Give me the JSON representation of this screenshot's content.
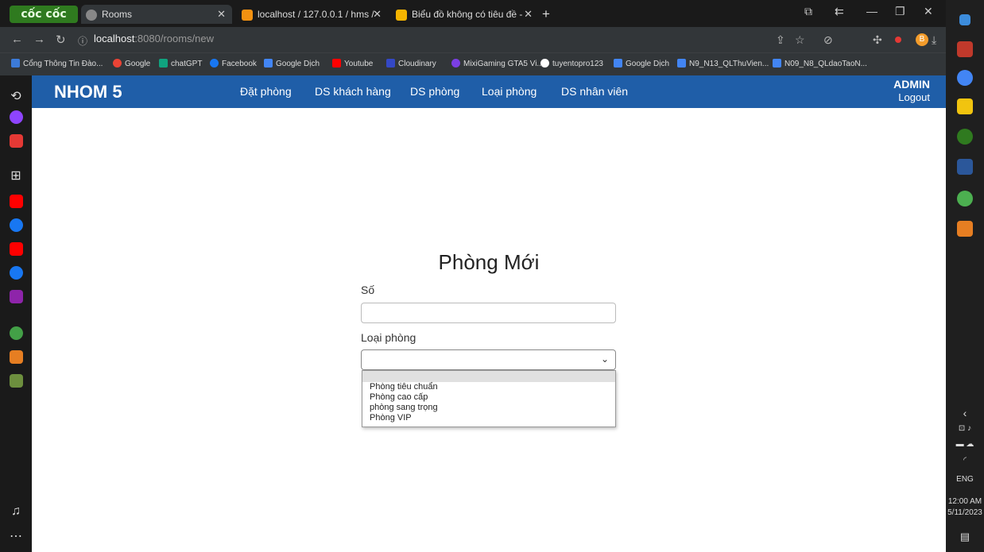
{
  "browser": {
    "brand": "cốc cốc",
    "tabs": [
      {
        "label": "Rooms",
        "active": true
      },
      {
        "label": "localhost / 127.0.0.1 / hms / ",
        "active": false
      },
      {
        "label": "Biểu đồ không có tiêu đề - ",
        "active": false
      }
    ],
    "url_host": "localhost",
    "url_path": ":8080/rooms/new",
    "bookmarks": [
      {
        "label": "Cổng Thông Tin Đào...",
        "color": "#3c7bd9"
      },
      {
        "label": "Google",
        "color": "#ea4335"
      },
      {
        "label": "chatGPT",
        "color": "#10a37f"
      },
      {
        "label": "Facebook",
        "color": "#1877f2"
      },
      {
        "label": "Google Dịch",
        "color": "#4285f4"
      },
      {
        "label": "Youtube",
        "color": "#ff0000"
      },
      {
        "label": "Cloudinary",
        "color": "#3448c5"
      },
      {
        "label": "MixiGaming GTA5 Vi...",
        "color": "#7b3fe4"
      },
      {
        "label": "tuyentopro123",
        "color": "#ffffff"
      },
      {
        "label": "Google Dịch",
        "color": "#4285f4"
      },
      {
        "label": "N9_N13_QLThuVien...",
        "color": "#4285f4"
      },
      {
        "label": "N09_N8_QLdaoTaoN...",
        "color": "#4285f4"
      }
    ],
    "profile_initial": "B"
  },
  "app": {
    "logo": "NHOM 5",
    "nav": [
      "Đặt phòng",
      "DS khách hàng",
      "DS phòng",
      "Loại phòng",
      "DS nhân viên"
    ],
    "user": "ADMIN",
    "logout": "Logout"
  },
  "form": {
    "title": "Phòng Mới",
    "so_label": "Số",
    "so_value": "",
    "loai_label": "Loại phòng",
    "loai_selected": "",
    "options": [
      "",
      "Phòng tiêu chuẩn",
      "Phòng cao cấp",
      "phòng sang trọng",
      "Phòng VIP"
    ]
  },
  "taskbar": {
    "lang": "ENG",
    "time": "12:00 AM",
    "date": "5/11/2023"
  },
  "colors": {
    "navbar": "#1f5ea8",
    "brand_green": "#2f7a1f"
  }
}
